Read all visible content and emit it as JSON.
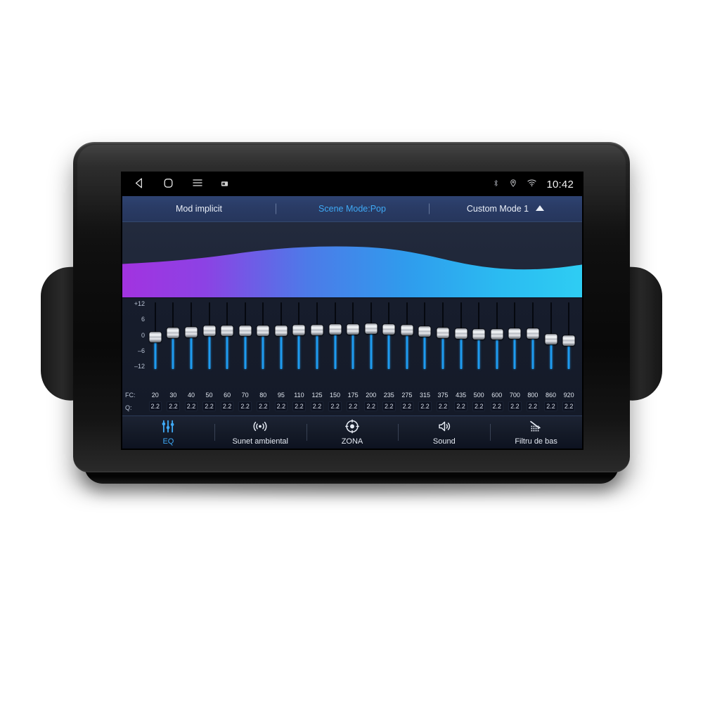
{
  "device": {
    "type": "car-head-unit",
    "label": "Android car stereo"
  },
  "statusbar": {
    "nav": [
      {
        "name": "back-icon",
        "label": "Back"
      },
      {
        "name": "home-icon",
        "label": "Home"
      },
      {
        "name": "menu-icon",
        "label": "Menu"
      },
      {
        "name": "screenshot-icon",
        "label": "Screenshot"
      }
    ],
    "indicators": [
      {
        "name": "bluetooth-icon",
        "label": "Bluetooth"
      },
      {
        "name": "location-icon",
        "label": "GPS"
      },
      {
        "name": "wifi-icon",
        "label": "Wi-Fi"
      }
    ],
    "clock": "10:42"
  },
  "modebar": {
    "items": [
      {
        "label": "Mod implicit",
        "active": false
      },
      {
        "label": "Scene Mode:Pop",
        "active": true
      },
      {
        "label": "Custom Mode 1",
        "active": false,
        "caret": "triangle-up-icon"
      }
    ]
  },
  "curve": {
    "gradient_start": "#a233e0",
    "gradient_mid": "#3c7ae8",
    "gradient_end": "#2ec5f0",
    "background": "#222a3d"
  },
  "eq": {
    "db_axis": [
      "+12",
      "6",
      "0",
      "-6",
      "-12"
    ],
    "db_min": -12,
    "db_max": 12,
    "fc_label": "FC:",
    "q_label": "Q:",
    "accent": "#1e9bf0",
    "bands": [
      {
        "fc": "20",
        "q": "2.2",
        "gain": -0.6
      },
      {
        "fc": "30",
        "q": "2.2",
        "gain": 1.1
      },
      {
        "fc": "40",
        "q": "2.2",
        "gain": 1.6
      },
      {
        "fc": "50",
        "q": "2.2",
        "gain": 2.0
      },
      {
        "fc": "60",
        "q": "2.2",
        "gain": 2.0
      },
      {
        "fc": "70",
        "q": "2.2",
        "gain": 2.0
      },
      {
        "fc": "80",
        "q": "2.2",
        "gain": 2.0
      },
      {
        "fc": "95",
        "q": "2.2",
        "gain": 2.2
      },
      {
        "fc": "110",
        "q": "2.2",
        "gain": 2.4
      },
      {
        "fc": "125",
        "q": "2.2",
        "gain": 2.4
      },
      {
        "fc": "150",
        "q": "2.2",
        "gain": 2.6
      },
      {
        "fc": "175",
        "q": "2.2",
        "gain": 2.8
      },
      {
        "fc": "200",
        "q": "2.2",
        "gain": 3.0
      },
      {
        "fc": "235",
        "q": "2.2",
        "gain": 2.8
      },
      {
        "fc": "275",
        "q": "2.2",
        "gain": 2.4
      },
      {
        "fc": "315",
        "q": "2.2",
        "gain": 1.8
      },
      {
        "fc": "375",
        "q": "2.2",
        "gain": 1.2
      },
      {
        "fc": "435",
        "q": "2.2",
        "gain": 0.8
      },
      {
        "fc": "500",
        "q": "2.2",
        "gain": 0.6
      },
      {
        "fc": "600",
        "q": "2.2",
        "gain": 0.6
      },
      {
        "fc": "700",
        "q": "2.2",
        "gain": 0.8
      },
      {
        "fc": "800",
        "q": "2.2",
        "gain": 0.8
      },
      {
        "fc": "860",
        "q": "2.2",
        "gain": -1.4
      },
      {
        "fc": "920",
        "q": "2.2",
        "gain": -2.2
      }
    ]
  },
  "tabbar": {
    "items": [
      {
        "label": "EQ",
        "icon": "equalizer-icon",
        "active": true
      },
      {
        "label": "Sunet ambiental",
        "icon": "surround-icon",
        "active": false
      },
      {
        "label": "ZONA",
        "icon": "zone-target-icon",
        "active": false
      },
      {
        "label": "Sound",
        "icon": "speaker-icon",
        "active": false
      },
      {
        "label": "Filtru de bas",
        "icon": "bass-filter-icon",
        "active": false
      }
    ]
  }
}
